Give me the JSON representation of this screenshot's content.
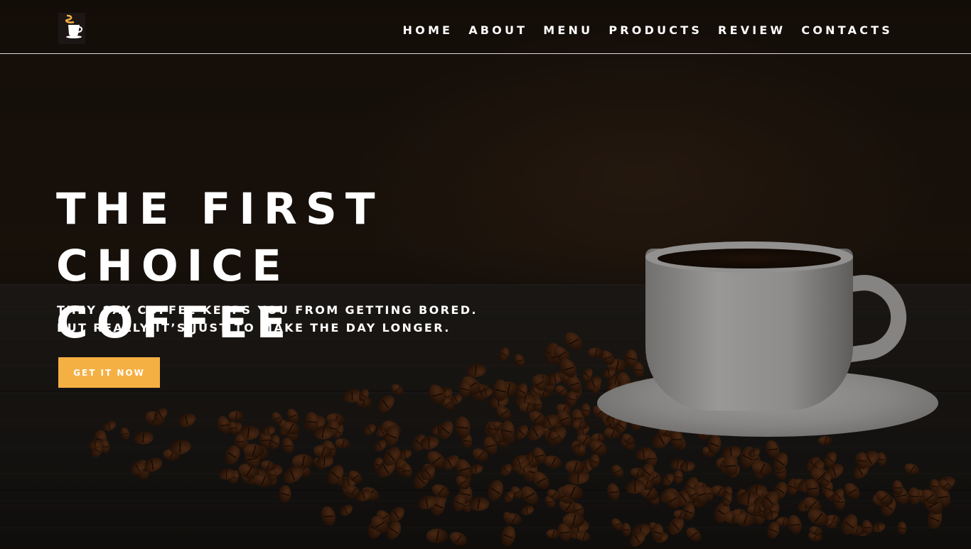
{
  "header": {
    "logo_icon": "coffee-cup-logo-icon",
    "nav": [
      {
        "label": "HOME"
      },
      {
        "label": "ABOUT"
      },
      {
        "label": "MENU"
      },
      {
        "label": "PRODUCTS"
      },
      {
        "label": "REVIEW"
      },
      {
        "label": "CONTACTS"
      }
    ]
  },
  "hero": {
    "title_line1": "THE FIRST CHOICE",
    "title_line2": "COFFEE",
    "subtitle_line1": "THEY SAY COFFEE KEEPS YOU FROM GETTING BORED.",
    "subtitle_line2": "BUT REALLY IT’S JUST TO MAKE THE DAY LONGER.",
    "cta_label": "GET IT NOW"
  },
  "colors": {
    "accent": "#f5b043",
    "text": "#ffffff",
    "background": "#120c08"
  }
}
